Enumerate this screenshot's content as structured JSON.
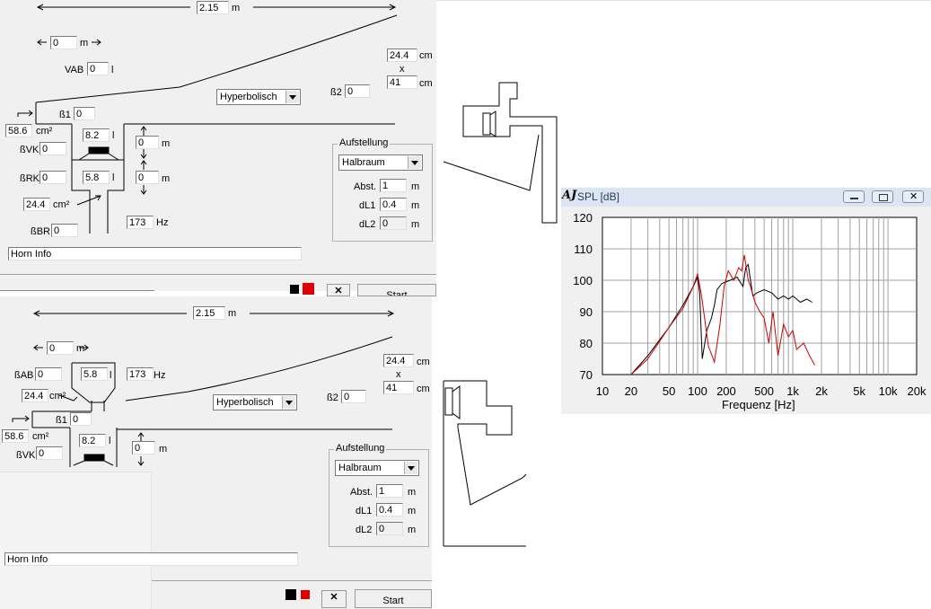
{
  "horn_top": {
    "length_value": "2.15",
    "length_unit": "m",
    "offset_value": "0",
    "offset_unit": "m",
    "vab_label": "VAB",
    "vab_value": "0",
    "vab_unit": "l",
    "mouth_w_value": "24.4",
    "mouth_w_unit": "cm",
    "times": "x",
    "mouth_h_value": "41",
    "mouth_h_unit": "cm",
    "flare": "Hyperbolisch",
    "b2_label": "ß2",
    "b2_value": "0",
    "b1_label": "ß1",
    "b1_value": "0",
    "throat_value": "58.6",
    "throat_unit": "cm²",
    "bvk_label": "ßVK",
    "bvk_value": "0",
    "vk_value": "8.2",
    "vk_unit": "l",
    "brk_label": "ßRK",
    "brk_value": "0",
    "vr_value": "5.8",
    "vr_unit": "l",
    "d1_value": "0",
    "d1_unit": "m",
    "d2_value": "0",
    "d2_unit": "m",
    "port_area_value": "24.4",
    "port_area_unit": "cm²",
    "freq_value": "173",
    "freq_unit": "Hz",
    "bbr_label": "ßBR",
    "bbr_value": "0",
    "info": "Horn Info",
    "start_label": "Start"
  },
  "horn_bottom": {
    "length_value": "2.15",
    "length_unit": "m",
    "offset_value": "0",
    "offset_unit": "m",
    "bab_label": "ßAB",
    "bab_value": "0",
    "vr_value": "5.8",
    "vr_unit": "l",
    "freq_value": "173",
    "freq_unit": "Hz",
    "port_area_value": "24.4",
    "port_area_unit": "cm²",
    "mouth_w_value": "24.4",
    "mouth_w_unit": "cm",
    "times": "x",
    "mouth_h_value": "41",
    "mouth_h_unit": "cm",
    "flare": "Hyperbolisch",
    "b2_label": "ß2",
    "b2_value": "0",
    "b1_label": "ß1",
    "b1_value": "0",
    "throat_value": "58.6",
    "throat_unit": "cm²",
    "bvk_label": "ßVK",
    "bvk_value": "0",
    "vk_value": "8.2",
    "vk_unit": "l",
    "d1_value": "0",
    "d1_unit": "m",
    "info": "Horn Info",
    "start_label": "Start"
  },
  "aufstellung_top": {
    "title": "Aufstellung",
    "mode": "Halbraum",
    "abst_label": "Abst.",
    "abst_value": "1",
    "abst_unit": "m",
    "dl1_label": "dL1",
    "dl1_value": "0.4",
    "dl1_unit": "m",
    "dl2_label": "dL2",
    "dl2_value": "0",
    "dl2_unit": "m"
  },
  "aufstellung_bottom": {
    "title": "Aufstellung",
    "mode": "Halbraum",
    "abst_label": "Abst.",
    "abst_value": "1",
    "abst_unit": "m",
    "dl1_label": "dL1",
    "dl1_value": "0.4",
    "dl1_unit": "m",
    "dl2_label": "dL2",
    "dl2_value": "0",
    "dl2_unit": "m"
  },
  "spl_window": {
    "logo": "AJ",
    "title": "SPL [dB]"
  },
  "chart_data": {
    "type": "line",
    "title": "SPL [dB]",
    "xlabel": "Frequenz [Hz]",
    "ylabel": "",
    "x_scale": "log",
    "xlim": [
      10,
      20000
    ],
    "ylim": [
      70,
      120
    ],
    "x_ticks": [
      10,
      20,
      50,
      100,
      200,
      500,
      1000,
      2000,
      5000,
      10000,
      20000
    ],
    "x_tick_labels": [
      "10",
      "20",
      "50",
      "100",
      "200",
      "500",
      "1k",
      "2k",
      "5k",
      "10k",
      "20k"
    ],
    "y_ticks": [
      70,
      80,
      90,
      100,
      110,
      120
    ],
    "grid": true,
    "series": [
      {
        "color": "#000000",
        "points": [
          [
            20,
            70
          ],
          [
            30,
            76
          ],
          [
            50,
            85
          ],
          [
            70,
            92
          ],
          [
            90,
            98
          ],
          [
            100,
            101
          ],
          [
            105,
            96
          ],
          [
            112,
            75
          ],
          [
            125,
            84
          ],
          [
            140,
            88
          ],
          [
            150,
            92
          ],
          [
            160,
            97
          ],
          [
            180,
            99
          ],
          [
            220,
            100
          ],
          [
            260,
            101
          ],
          [
            300,
            98
          ],
          [
            320,
            104
          ],
          [
            340,
            105
          ],
          [
            380,
            95
          ],
          [
            420,
            96
          ],
          [
            500,
            97
          ],
          [
            600,
            96
          ],
          [
            700,
            94
          ],
          [
            800,
            95
          ],
          [
            900,
            94
          ],
          [
            1000,
            95
          ],
          [
            1200,
            93
          ],
          [
            1400,
            94
          ],
          [
            1600,
            93
          ]
        ]
      },
      {
        "color": "#cc0000",
        "points": [
          [
            20,
            70
          ],
          [
            30,
            75
          ],
          [
            50,
            85
          ],
          [
            70,
            91
          ],
          [
            90,
            98
          ],
          [
            100,
            102
          ],
          [
            110,
            95
          ],
          [
            130,
            79
          ],
          [
            150,
            74
          ],
          [
            170,
            85
          ],
          [
            190,
            98
          ],
          [
            210,
            103
          ],
          [
            240,
            100
          ],
          [
            270,
            104
          ],
          [
            290,
            103
          ],
          [
            310,
            108
          ],
          [
            340,
            100
          ],
          [
            360,
            98
          ],
          [
            400,
            93
          ],
          [
            450,
            90
          ],
          [
            500,
            88
          ],
          [
            560,
            80
          ],
          [
            620,
            90
          ],
          [
            700,
            76
          ],
          [
            800,
            86
          ],
          [
            900,
            82
          ],
          [
            1000,
            84
          ],
          [
            1100,
            78
          ],
          [
            1300,
            80
          ],
          [
            1500,
            76
          ],
          [
            1700,
            73
          ]
        ]
      }
    ]
  }
}
